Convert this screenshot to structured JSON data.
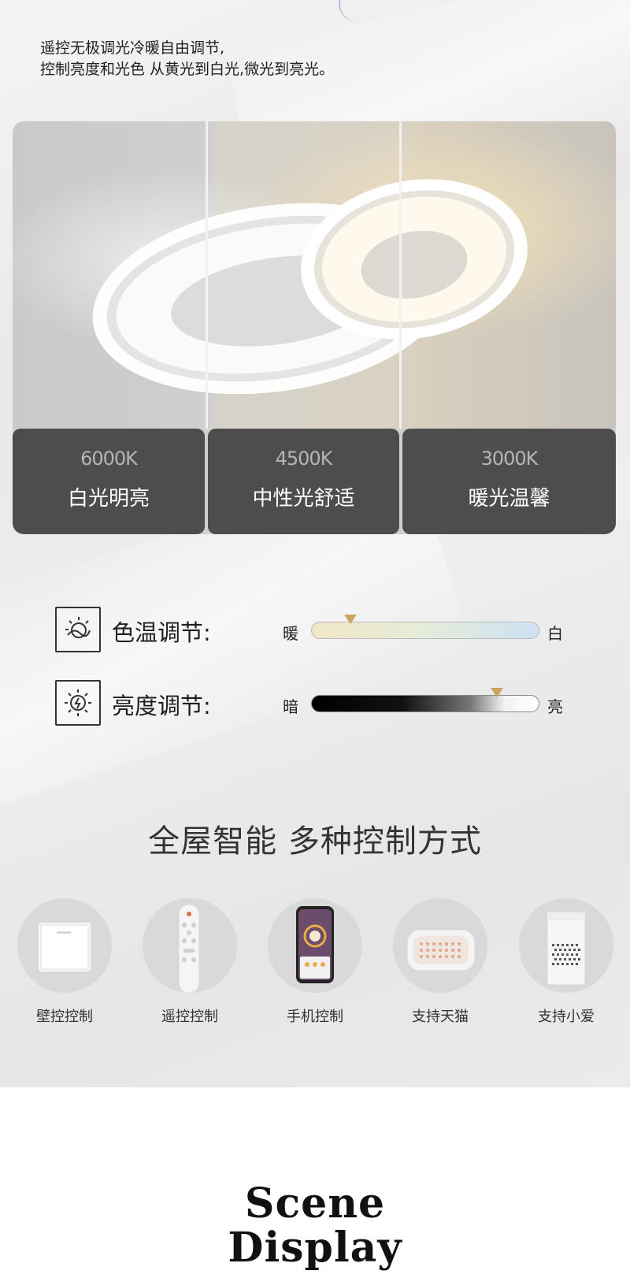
{
  "intro": {
    "line1": "遥控无极调光冷暖自由调节,",
    "line2": "控制亮度和光色 从黄光到白光,微光到亮光。"
  },
  "color_temps": [
    {
      "kelvin": "6000K",
      "name": "白光明亮"
    },
    {
      "kelvin": "4500K",
      "name": "中性光舒适"
    },
    {
      "kelvin": "3000K",
      "name": "暖光温馨"
    }
  ],
  "adjust": {
    "temperature": {
      "label": "色温调节:",
      "left": "暖",
      "right": "白",
      "level": 0.17,
      "icon": "color-temperature-icon"
    },
    "brightness": {
      "label": "亮度调节:",
      "left": "暗",
      "right": "亮",
      "level": 0.81,
      "icon": "brightness-icon"
    }
  },
  "smart": {
    "title": "全屋智能 多种控制方式",
    "controls": [
      {
        "label": "壁控控制",
        "icon": "wall-switch-icon"
      },
      {
        "label": "遥控控制",
        "icon": "remote-control-icon"
      },
      {
        "label": "手机控制",
        "icon": "smartphone-icon"
      },
      {
        "label": "支持天猫",
        "icon": "tmall-speaker-icon"
      },
      {
        "label": "支持小爱",
        "icon": "xiaoai-speaker-icon"
      }
    ]
  },
  "scene": {
    "line1": "Scene",
    "line2": "Display"
  },
  "colors": {
    "card_bg": "#4d4d4d",
    "thumb": "#c9a55f",
    "warm_glow": "#f3d9a8"
  }
}
